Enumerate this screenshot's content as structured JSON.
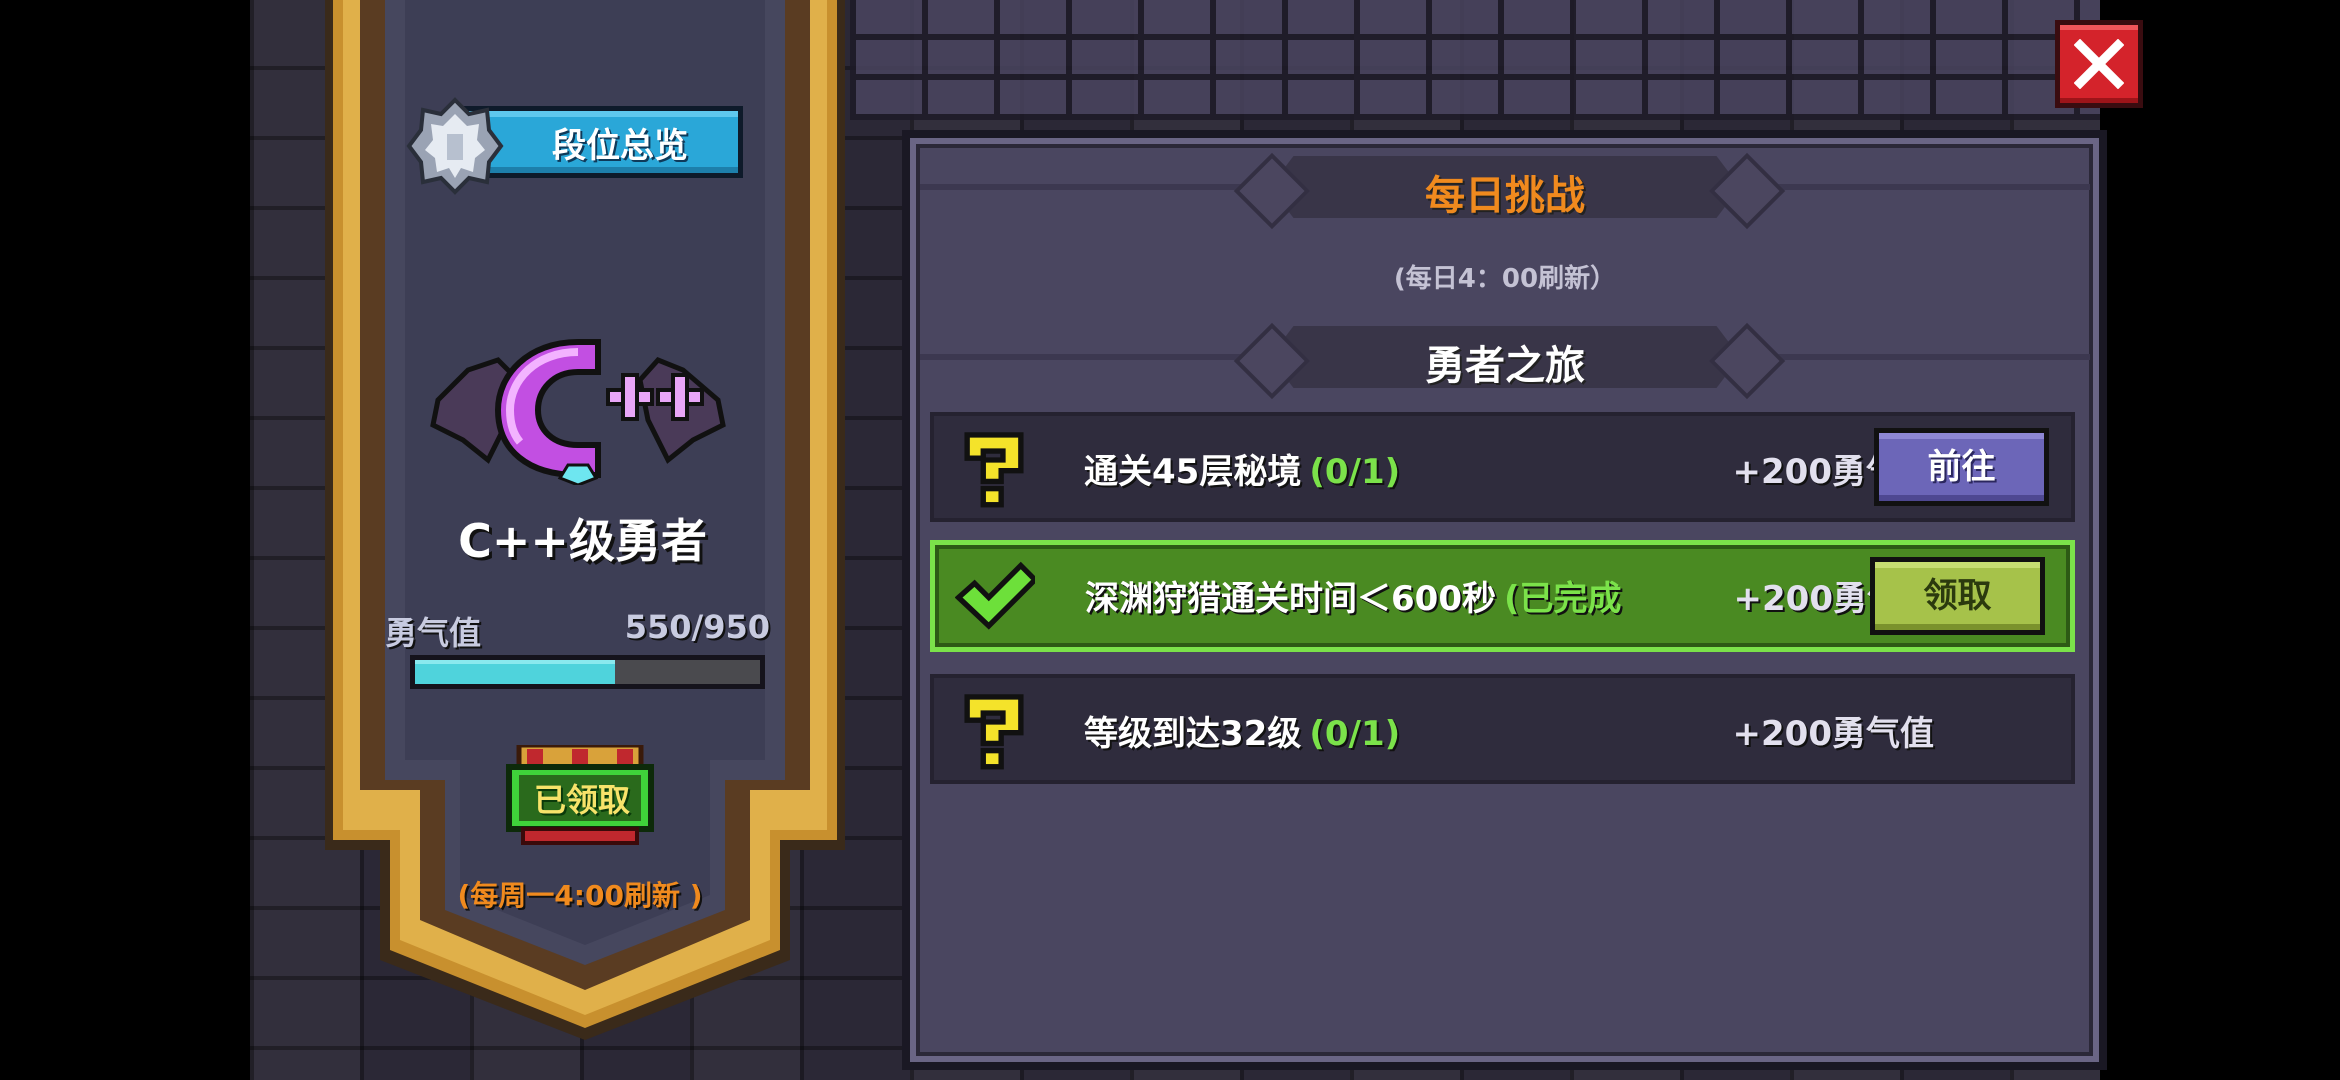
{
  "left_panel": {
    "rank_overview_label": "段位总览",
    "rank_title": "C++级勇者",
    "courage": {
      "label": "勇气值",
      "value_text": "550/950",
      "current": 550,
      "max": 950
    },
    "claimed_label": "已领取",
    "weekly_refresh": "(每周一4:00刷新 )"
  },
  "right_panel": {
    "daily_title": "每日挑战",
    "daily_refresh": "(每日4：00刷新）",
    "section_title": "勇者之旅",
    "tasks": [
      {
        "text": "通关45层秘境",
        "progress": "(0/1)",
        "reward": "+200勇气值",
        "status": "incomplete",
        "icon": "question-mark-icon",
        "button_label": "前往"
      },
      {
        "text": "深渊狩猎通关时间＜600秒",
        "progress": "(已完成",
        "reward": "+200勇气值",
        "status": "complete",
        "icon": "checkmark-icon",
        "button_label": "领取"
      },
      {
        "text": "等级到达32级",
        "progress": "(0/1)",
        "reward": "+200勇气值",
        "status": "incomplete",
        "icon": "question-mark-icon"
      }
    ]
  },
  "colors": {
    "accent_orange": "#f08a1e",
    "progress_green": "#7be24a",
    "courage_bar": "#4fd3dc",
    "close_red": "#d4232b"
  },
  "icons": {
    "close": "close-icon",
    "rank_emblem": "silver-crest-icon",
    "rank_badge": "cpp-rank-badge-icon",
    "chest": "treasure-chest-icon"
  }
}
